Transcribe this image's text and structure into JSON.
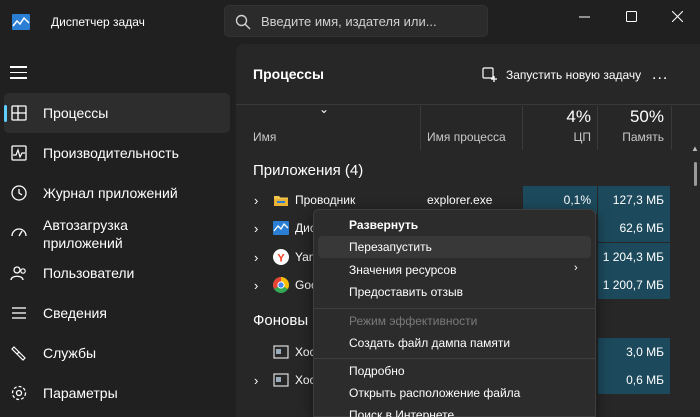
{
  "app": {
    "title": "Диспетчер задач",
    "search_placeholder": "Введите имя, издателя или..."
  },
  "window_controls": {
    "minimize": "—",
    "maximize": "☐",
    "close": "✕"
  },
  "sidebar": {
    "items": [
      {
        "label": "Процессы",
        "icon": "processes-icon",
        "active": true
      },
      {
        "label": "Производительность",
        "icon": "performance-icon"
      },
      {
        "label": "Журнал приложений",
        "icon": "app-history-icon"
      },
      {
        "label": "Автозагрузка приложений",
        "label_line1": "Автозагрузка",
        "label_line2": "приложений",
        "icon": "startup-icon"
      },
      {
        "label": "Пользователи",
        "icon": "users-icon"
      },
      {
        "label": "Сведения",
        "icon": "details-icon"
      },
      {
        "label": "Службы",
        "icon": "services-icon"
      },
      {
        "label": "Параметры",
        "icon": "settings-icon"
      }
    ]
  },
  "main": {
    "title": "Процессы",
    "run_task_label": "Запустить новую задачу",
    "more_label": "...",
    "columns": {
      "name": "Имя",
      "process_name": "Имя процесса",
      "cpu_pct": "4%",
      "cpu_label": "ЦП",
      "mem_pct": "50%",
      "mem_label": "Память"
    },
    "groups": {
      "apps": "Приложения (4)",
      "background": "Фоновы"
    },
    "rows": [
      {
        "name": "Проводник",
        "process": "explorer.exe",
        "cpu": "0,1%",
        "mem": "127,3 МБ",
        "icon": "folder-icon"
      },
      {
        "name": "Дис",
        "process": "",
        "cpu": "",
        "mem": "62,6 МБ",
        "icon": "taskmanager-icon"
      },
      {
        "name": "Yan",
        "process": "",
        "cpu": "",
        "mem": "1 204,3 МБ",
        "icon": "yandex-icon"
      },
      {
        "name": "Goo",
        "process": "",
        "cpu": "",
        "mem": "1 200,7 МБ",
        "icon": "chrome-icon"
      },
      {
        "name": "Хос",
        "process": "",
        "cpu": "",
        "mem": "3,0 МБ",
        "icon": "service-host-icon"
      },
      {
        "name": "Хос",
        "process": "",
        "cpu": "",
        "mem": "0,6 МБ",
        "icon": "service-host-icon"
      }
    ]
  },
  "context_menu": {
    "items": [
      {
        "label": "Развернуть",
        "bold": true
      },
      {
        "label": "Перезапустить",
        "hover": true
      },
      {
        "label": "Значения ресурсов",
        "submenu": true
      },
      {
        "label": "Предоставить отзыв"
      },
      {
        "label": "Режим эффективности",
        "disabled": true
      },
      {
        "label": "Создать файл дампа памяти"
      },
      {
        "label": "Подробно"
      },
      {
        "label": "Открыть расположение файла"
      },
      {
        "label": "Поиск в Интернете"
      }
    ]
  },
  "colors": {
    "accent": "#60cdff",
    "highlight_cell": "#1c4a5c",
    "background": "#1f1f1f",
    "panel": "#272727"
  }
}
